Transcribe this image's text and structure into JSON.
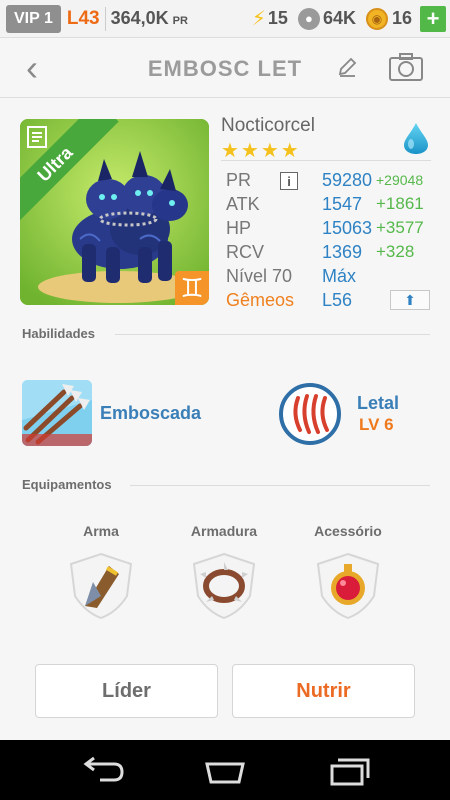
{
  "status_bar": {
    "vip": "VIP 1",
    "level": "L43",
    "power_value": "364,0K",
    "power_unit": "PR",
    "energy": "15",
    "food": "64K",
    "gold": "16",
    "add_label": "+"
  },
  "header": {
    "back_label": "‹",
    "title": "EMBOSC LET"
  },
  "monster": {
    "rarity": "Ultra",
    "name": "Nocticorcel",
    "stars": "★★★★",
    "element": "water-drop",
    "zodiac_glyph": "♊"
  },
  "stats": {
    "pr_label": "PR",
    "pr_value": "59280",
    "pr_bonus": "+29048",
    "info_label": "i",
    "atk_label": "ATK",
    "atk_value": "1547",
    "atk_bonus": "+1861",
    "hp_label": "HP",
    "hp_value": "15063",
    "hp_bonus": "+3577",
    "rcv_label": "RCV",
    "rcv_value": "1369",
    "rcv_bonus": "+328",
    "level_label": "Nível 70",
    "level_value": "Máx",
    "twin_label": "Gêmeos",
    "twin_value": "L56",
    "up_label": "⬆"
  },
  "skills": {
    "section_title": "Habilidades",
    "active_name": "Emboscada",
    "passive_name": "Letal",
    "passive_level": "LV 6"
  },
  "equipment": {
    "section_title": "Equipamentos",
    "weapon_label": "Arma",
    "armor_label": "Armadura",
    "accessory_label": "Acessório"
  },
  "actions": {
    "leader_label": "Líder",
    "feed_label": "Nutrir"
  },
  "colors": {
    "accent_blue": "#2f83c4",
    "accent_orange": "#ef7a1e",
    "bonus_green": "#56b84b",
    "star_gold": "#f5c11d"
  }
}
